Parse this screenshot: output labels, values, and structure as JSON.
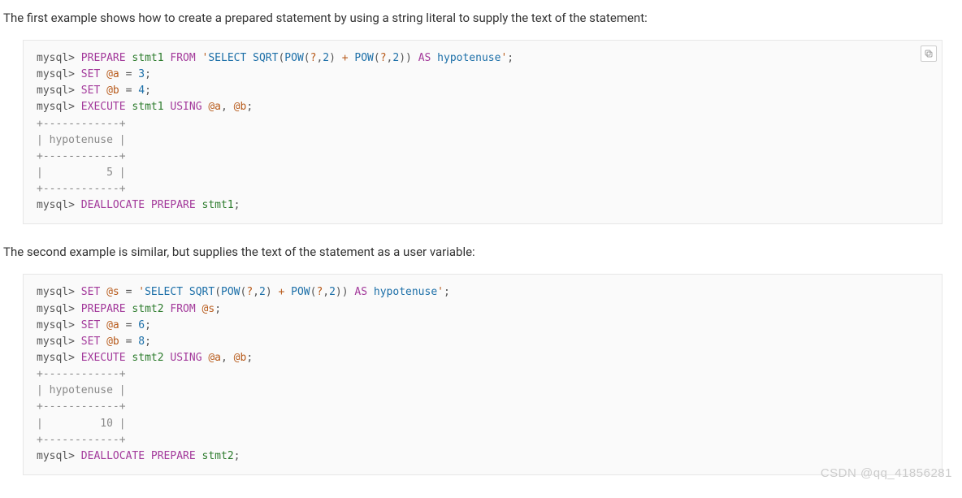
{
  "para1": "The first example shows how to create a prepared statement by using a string literal to supply the text of the statement:",
  "para2": "The second example is similar, but supplies the text of the statement as a user variable:",
  "watermark": "CSDN @qq_41856281",
  "copy_btn_label": "Copy",
  "code1": {
    "prompt": "mysql>",
    "kw_prepare": "PREPARE",
    "stmt": "stmt1",
    "kw_from": "FROM",
    "str_open": "'",
    "fn_select": "SELECT",
    "fn_sqrt": "SQRT",
    "fn_pow": "POW",
    "q": "?",
    "two": "2",
    "plus": "+",
    "as": "AS",
    "hypo": "hypotenuse",
    "str_close": "'",
    "semi": ";",
    "kw_set": "SET",
    "var_a": "@a",
    "eq": "=",
    "val_a": "3",
    "var_b": "@b",
    "val_b": "4",
    "kw_execute": "EXECUTE",
    "kw_using": "USING",
    "comma": ",",
    "tbl_border": "+------------+",
    "tbl_header": "| hypotenuse |",
    "tbl_row": "|          5 |",
    "kw_dealloc": "DEALLOCATE"
  },
  "code2": {
    "prompt": "mysql>",
    "kw_set": "SET",
    "var_s": "@s",
    "eq": "=",
    "str_open": "'",
    "fn_select": "SELECT",
    "fn_sqrt": "SQRT",
    "fn_pow": "POW",
    "q": "?",
    "two": "2",
    "plus": "+",
    "as": "AS",
    "hypo": "hypotenuse",
    "str_close": "'",
    "semi": ";",
    "kw_prepare": "PREPARE",
    "stmt": "stmt2",
    "kw_from": "FROM",
    "var_a": "@a",
    "val_a": "6",
    "var_b": "@b",
    "val_b": "8",
    "kw_execute": "EXECUTE",
    "kw_using": "USING",
    "comma": ",",
    "tbl_border": "+------------+",
    "tbl_header": "| hypotenuse |",
    "tbl_row": "|         10 |",
    "kw_dealloc": "DEALLOCATE"
  }
}
